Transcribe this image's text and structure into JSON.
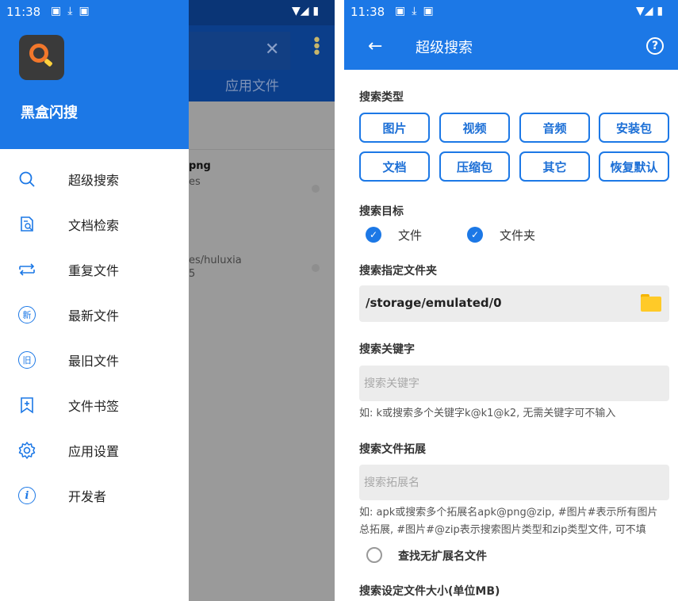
{
  "left_screen": {
    "status_bar": {
      "time": "11:38",
      "icons": [
        "image-icon",
        "download-icon",
        "a-icon"
      ],
      "right_icons": "▼◢ ▮"
    },
    "background": {
      "tab_label": "应用文件",
      "row1_text1": "png",
      "row1_text2": "es",
      "row2_text1": "es/huluxia",
      "row2_text2": "5"
    },
    "drawer": {
      "app_name": "黑盒闪搜",
      "items": [
        {
          "label": "超级搜索",
          "icon": "search-icon"
        },
        {
          "label": "文档检索",
          "icon": "document-search-icon"
        },
        {
          "label": "重复文件",
          "icon": "repeat-icon"
        },
        {
          "label": "最新文件",
          "icon": "new-icon"
        },
        {
          "label": "最旧文件",
          "icon": "old-icon"
        },
        {
          "label": "文件书签",
          "icon": "bookmark-add-icon"
        },
        {
          "label": "应用设置",
          "icon": "gear-icon"
        },
        {
          "label": "开发者",
          "icon": "info-icon"
        }
      ],
      "new_glyph": "新",
      "old_glyph": "旧",
      "info_glyph": "i"
    }
  },
  "right_screen": {
    "status_bar": {
      "time": "11:38",
      "right_icons": "▼◢ ▮"
    },
    "app_bar": {
      "back": "←",
      "title": "超级搜索",
      "help": "?"
    },
    "search_type": {
      "label": "搜索类型",
      "chips": [
        "图片",
        "视频",
        "音频",
        "安装包",
        "文档",
        "压缩包",
        "其它",
        "恢复默认"
      ]
    },
    "search_target": {
      "label": "搜索目标",
      "options": [
        {
          "label": "文件",
          "checked": true
        },
        {
          "label": "文件夹",
          "checked": true
        }
      ]
    },
    "folder": {
      "label": "搜索指定文件夹",
      "path": "/storage/emulated/0"
    },
    "keyword": {
      "label": "搜索关键字",
      "placeholder": "搜索关键字",
      "value": "",
      "hint": "如: k或搜索多个关键字k@k1@k2, 无需关键字可不输入"
    },
    "extension": {
      "label": "搜索文件拓展",
      "placeholder": "搜索拓展名",
      "value": "",
      "hint_line1": "如: apk或搜索多个拓展名apk@png@zip, #图片#表示所有图片",
      "hint_line2": "总拓展, #图片#@zip表示搜索图片类型和zip类型文件, 可不填",
      "no_ext_option": "查找无扩展名文件"
    },
    "size": {
      "label": "搜索设定文件大小(单位MB)"
    },
    "colors": {
      "primary": "#1c78e6",
      "field_bg": "#ececec",
      "folder_icon": "#ffca28"
    }
  }
}
